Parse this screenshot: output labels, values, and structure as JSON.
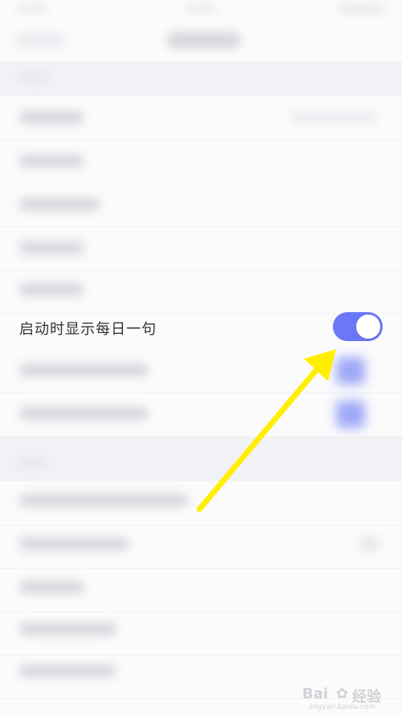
{
  "settings": {
    "highlighted_item": {
      "label": "启动时显示每日一句",
      "toggle_state": "on",
      "toggle_color": "#6a78f7"
    }
  },
  "annotation": {
    "arrow_color": "#ffee00",
    "arrow_icon": "arrow-icon"
  },
  "watermark": {
    "brand": "Bai",
    "paw_icon": "paw-icon",
    "brand_suffix": "经验",
    "sub": "jingyan.baidu.com"
  }
}
